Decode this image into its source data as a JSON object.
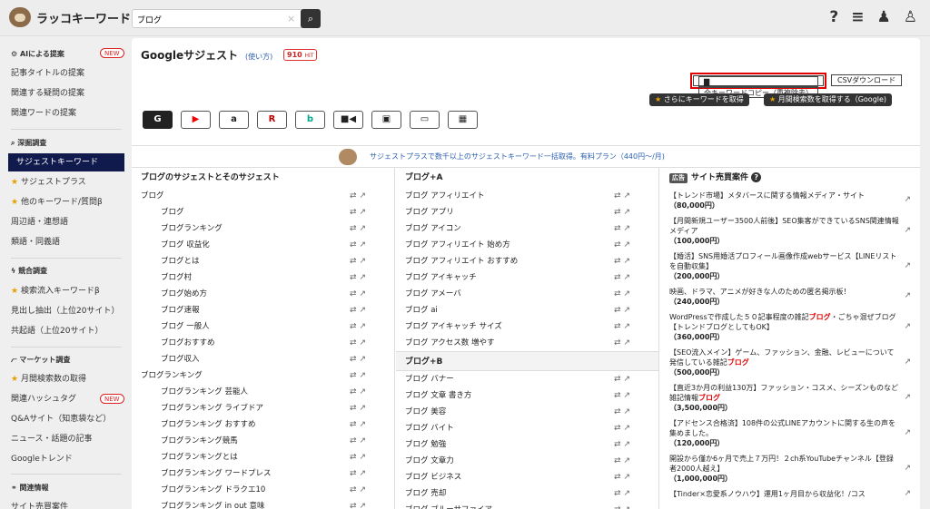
{
  "app": {
    "logo_text": "ラッコキーワード"
  },
  "search": {
    "value": "ブログ",
    "clear": "×",
    "button": "🔍"
  },
  "topnav": {
    "help": "?",
    "menu": "☰",
    "bell": "🔔",
    "user": "👤"
  },
  "sidebar": {
    "ai_head": "AIによる提案",
    "new": "NEW",
    "ai_items": [
      "記事タイトルの提案",
      "関連する疑問の提案",
      "関連ワードの提案"
    ],
    "deep_head": "深掘調査",
    "deep_items": [
      "サジェストキーワード",
      "サジェストプラス",
      "他のキーワード/質問β",
      "周辺語・連想語",
      "類語・同義語"
    ],
    "comp_head": "競合調査",
    "comp_items": [
      "検索流入キーワードβ",
      "見出し抽出（上位20サイト）",
      "共起語（上位20サイト）"
    ],
    "market_head": "マーケット調査",
    "market_items": [
      "月間検索数の取得",
      "関連ハッシュタグ",
      "Q&Aサイト（知恵袋など）",
      "ニュース・話題の記事",
      "Googleトレンド"
    ],
    "related_head": "関連情報",
    "related_items": [
      "サイト売買案件"
    ]
  },
  "main": {
    "title": "Googleサジェスト",
    "howto": "(使い方)",
    "hit_count": "910",
    "hit_unit": "HIT",
    "copy_btn": "全キーワードコピー（重複除去）",
    "csv_btn": "CSVダウンロード",
    "more_btn": "さらにキーワードを取得",
    "volume_btn": "月間検索数を取得する（Google)",
    "engines": [
      "G",
      "▶",
      "a",
      "R",
      "b",
      "■◀",
      "▣",
      "▭",
      "▦"
    ],
    "promo": "サジェストプラスで数千以上のサジェストキーワード一括取得。有料プラン（440円〜/月)"
  },
  "colA": {
    "head": "ブログのサジェストとそのサジェスト",
    "rows": [
      {
        "t": "ブログ",
        "i": 0
      },
      {
        "t": "ブログ",
        "i": 1
      },
      {
        "t": "ブログランキング",
        "i": 1
      },
      {
        "t": "ブログ 収益化",
        "i": 1
      },
      {
        "t": "ブログとは",
        "i": 1
      },
      {
        "t": "ブログ村",
        "i": 1
      },
      {
        "t": "ブログ始め方",
        "i": 1
      },
      {
        "t": "ブログ速報",
        "i": 1
      },
      {
        "t": "ブログ 一般人",
        "i": 1
      },
      {
        "t": "ブログおすすめ",
        "i": 1
      },
      {
        "t": "ブログ収入",
        "i": 1
      },
      {
        "t": "ブログランキング",
        "i": 0
      },
      {
        "t": "ブログランキング 芸能人",
        "i": 1
      },
      {
        "t": "ブログランキング ライブドア",
        "i": 1
      },
      {
        "t": "ブログランキング おすすめ",
        "i": 1
      },
      {
        "t": "ブログランキング競馬",
        "i": 1
      },
      {
        "t": "ブログランキングとは",
        "i": 1
      },
      {
        "t": "ブログランキング ワードプレス",
        "i": 1
      },
      {
        "t": "ブログランキング ドラクエ10",
        "i": 1
      },
      {
        "t": "ブログランキング in out 意味",
        "i": 1
      }
    ]
  },
  "colB": {
    "head": "ブログ+A",
    "rowsA": [
      "ブログ アフィリエイト",
      "ブログ アプリ",
      "ブログ アイコン",
      "ブログ アフィリエイト 始め方",
      "ブログ アフィリエイト おすすめ",
      "ブログ アイキャッチ",
      "ブログ アメーバ",
      "ブログ ai",
      "ブログ アイキャッチ サイズ",
      "ブログ アクセス数 増やす"
    ],
    "head2": "ブログ+B",
    "rowsB": [
      "ブログ バナー",
      "ブログ 文章 書き方",
      "ブログ 美容",
      "ブログ バイト",
      "ブログ 勉強",
      "ブログ 文章力",
      "ブログ ビジネス",
      "ブログ 売却",
      "ブログ ブルーサファイア"
    ]
  },
  "colC": {
    "ad": "広告",
    "head": "サイト売買案件",
    "help": "?",
    "items": [
      {
        "pre": "【トレンド市場】メタバースに関する情報メディア・サイト",
        "kw": "",
        "post": "",
        "price": "（80,000円）"
      },
      {
        "pre": "【月間新規ユーザー3500人前後】SEO集客ができているSNS関連情報メディア",
        "kw": "",
        "post": "",
        "price": "（100,000円）"
      },
      {
        "pre": "【婚活】SNS用婚活プロフィール画像作成webサービス【LINEリストを自動収集】",
        "kw": "",
        "post": "",
        "price": "（200,000円）"
      },
      {
        "pre": "映画、ドラマ、アニメが好きな人のための匿名掲示板！",
        "kw": "",
        "post": "",
        "price": "（240,000円）"
      },
      {
        "pre": "WordPressで作成した５０記事程度の雑記",
        "kw": "ブログ",
        "post": "・ごちゃ混ぜブログ【トレンドブログとしてもOK】",
        "price": "（360,000円）"
      },
      {
        "pre": "【SEO流入メイン】ゲーム、ファッション、金融、レビューについて発信している雑記",
        "kw": "ブログ",
        "post": "",
        "price": "（500,000円）"
      },
      {
        "pre": "【直近3か月の利益130万】ファッション・コスメ、シーズンものなど雑記情報",
        "kw": "ブログ",
        "post": "",
        "price": "（3,500,000円）"
      },
      {
        "pre": "【アドセンス合格済】108件の公式LINEアカウントに関する生の声を集めました。",
        "kw": "",
        "post": "",
        "price": "（120,000円）"
      },
      {
        "pre": "開設から僅か6ヶ月で売上７万円！２ch系YouTubeチャンネル【登録者2000人越え】",
        "kw": "",
        "post": "",
        "price": "（1,000,000円）"
      },
      {
        "pre": "【Tinder×恋愛系ノウハウ】運用1ヶ月目から収益化！/コス",
        "kw": "",
        "post": "",
        "price": ""
      }
    ]
  }
}
